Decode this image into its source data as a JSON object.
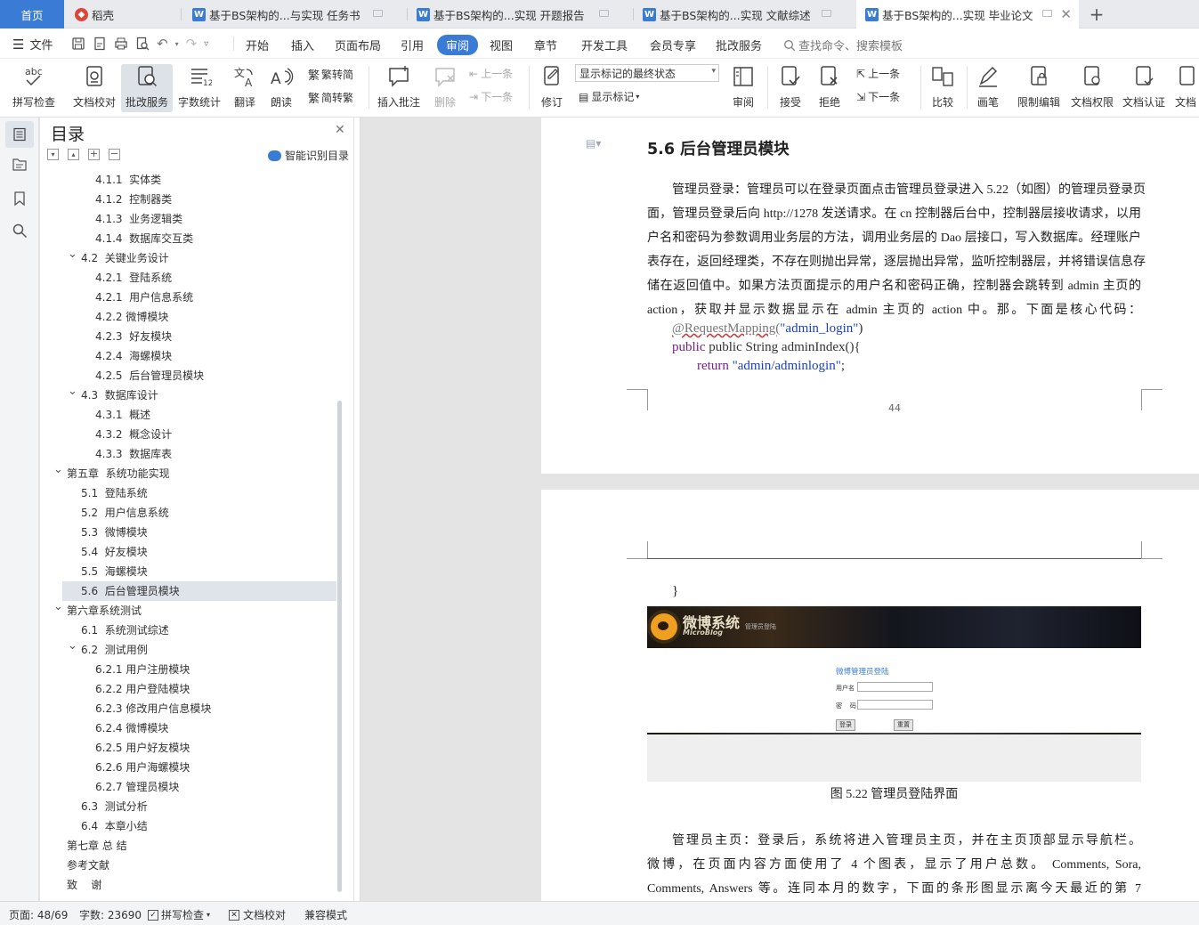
{
  "tabs": {
    "home": "首页",
    "daoke": "稻壳",
    "doc1": "基于BS架构的...与实现 任务书",
    "doc2": "基于BS架构的...实现 开题报告",
    "doc3": "基于BS架构的...实现 文献综述",
    "doc4": "基于BS架构的...实现 毕业论文",
    "new_tab": "+"
  },
  "menu": {
    "file": "文件",
    "items": [
      "开始",
      "插入",
      "页面布局",
      "引用",
      "审阅",
      "视图",
      "章节",
      "开发工具",
      "会员专享",
      "批改服务"
    ],
    "active": "审阅",
    "search": "查找命令、搜索模板"
  },
  "ribbon": {
    "spell": "拼写检查",
    "proofread": "文档校对",
    "correction": "批改服务",
    "wordcount": "字数统计",
    "translate": "翻译",
    "read": "朗读",
    "trad": "繁转简",
    "simp": "简转繁",
    "insert_comment": "插入批注",
    "delete": "删除",
    "prev": "上一条",
    "next": "下一条",
    "revise": "修订",
    "markup_select": "显示标记的最终状态",
    "show_markup": "显示标记",
    "review": "审阅",
    "accept": "接受",
    "reject": "拒绝",
    "prev2": "上一条",
    "next2": "下一条",
    "compare": "比较",
    "pen": "画笔",
    "restrict": "限制编辑",
    "permission": "文档权限",
    "certify": "文档认证",
    "more": "文档"
  },
  "toc": {
    "title": "目录",
    "smart": "智能识别目录",
    "items": [
      {
        "text": "4.1.1  实体类",
        "level": 3
      },
      {
        "text": "4.1.2  控制器类",
        "level": 3
      },
      {
        "text": "4.1.3  业务逻辑类",
        "level": 3
      },
      {
        "text": "4.1.4  数据库交互类",
        "level": 3
      },
      {
        "text": "4.2  关键业务设计",
        "level": 2,
        "expanded": true
      },
      {
        "text": "4.2.1  登陆系统",
        "level": 3
      },
      {
        "text": "4.2.1  用户信息系统",
        "level": 3
      },
      {
        "text": "4.2.2 微博模块",
        "level": 3
      },
      {
        "text": "4.2.3  好友模块",
        "level": 3
      },
      {
        "text": "4.2.4  海螺模块",
        "level": 3
      },
      {
        "text": "4.2.5  后台管理员模块",
        "level": 3
      },
      {
        "text": "4.3  数据库设计",
        "level": 2,
        "expanded": true
      },
      {
        "text": "4.3.1  概述",
        "level": 3
      },
      {
        "text": "4.3.2  概念设计",
        "level": 3
      },
      {
        "text": "4.3.3  数据库表",
        "level": 3
      },
      {
        "text": "第五章  系统功能实现",
        "level": 1,
        "expanded": true
      },
      {
        "text": "5.1  登陆系统",
        "level": 2
      },
      {
        "text": "5.2  用户信息系统",
        "level": 2
      },
      {
        "text": "5.3  微博模块",
        "level": 2
      },
      {
        "text": "5.4  好友模块",
        "level": 2
      },
      {
        "text": "5.5  海螺模块",
        "level": 2
      },
      {
        "text": "5.6  后台管理员模块",
        "level": 2,
        "selected": true
      },
      {
        "text": "第六章系统测试",
        "level": 1,
        "expanded": true
      },
      {
        "text": "6.1  系统测试综述",
        "level": 2
      },
      {
        "text": "6.2  测试用例",
        "level": 2,
        "expanded": true
      },
      {
        "text": "6.2.1 用户注册模块",
        "level": 3
      },
      {
        "text": "6.2.2 用户登陆模块",
        "level": 3
      },
      {
        "text": "6.2.3 修改用户信息模块",
        "level": 3
      },
      {
        "text": "6.2.4 微博模块",
        "level": 3
      },
      {
        "text": "6.2.5 用户好友模块",
        "level": 3
      },
      {
        "text": "6.2.6 用户海螺模块",
        "level": 3
      },
      {
        "text": "6.2.7 管理员模块",
        "level": 3
      },
      {
        "text": "6.3  测试分析",
        "level": 2
      },
      {
        "text": "6.4  本章小结",
        "level": 2
      },
      {
        "text": "第七章 总 结",
        "level": 1
      },
      {
        "text": "参考文献",
        "level": 1
      },
      {
        "text": "致    谢",
        "level": 1
      }
    ]
  },
  "doc": {
    "heading": "5.6  后台管理员模块",
    "para1_lines": [
      "管理员登录：管理员可以在登录页面点击管理员登录进入 5.22（如图）的管理员登录页",
      "面，管理员登录后向 http://1278 发送请求。在 cn 控制器后台中，控制器层接收请求，以用",
      "户名和密码为参数调用业务层的方法，调用业务层的 Dao 层接口，写入数据库。经理账户",
      "表存在，返回经理类，不存在则抛出异常，逐层抛出异常，监听控制器层，并将错误信息存",
      "储在返回值中。如果方法页面提示的用户名和密码正确，控制器会跳转到 admin 主页的",
      "action，获取并显示数据显示在 admin 主页的 action 中。那。下面是核心代码："
    ],
    "code1": "@RequestMapping(",
    "code1_str": "\"admin_login\"",
    "code1_end": ")",
    "code2": "public String adminIndex(){",
    "code3_kw": "return ",
    "code3_str": "\"admin/adminlogin\"",
    "code3_end": ";",
    "page_number": "44",
    "brace": "}",
    "figure": {
      "banner_title": "微博系统",
      "banner_sub": "MicroBlog",
      "banner_tag": "管理员登陆",
      "login_title": "微博管理员登陆",
      "user_label": "用户名",
      "pass_label": "密    码",
      "login_btn": "登录",
      "reset_btn": "重置"
    },
    "caption": "图 5.22 管理员登陆界面",
    "para2_lines": [
      "管理员主页：登录后，系统将进入管理员主页，并在主页顶部显示导航栏。",
      "微博，在页面内容方面使用了 4 个图表，显示了用户总数。  Comments, Sora,",
      "Comments, Answers  等。连同本月的数字，下面的条形图显示离今天最近的第 7"
    ]
  },
  "status": {
    "page": "页面: 48/69",
    "words": "字数: 23690",
    "spell": "拼写检查",
    "proof": "文档校对",
    "compat": "兼容模式"
  },
  "colors": {
    "accent": "#3a7bd5",
    "keyword": "#7a1f8a",
    "string": "#1a3fbf"
  }
}
